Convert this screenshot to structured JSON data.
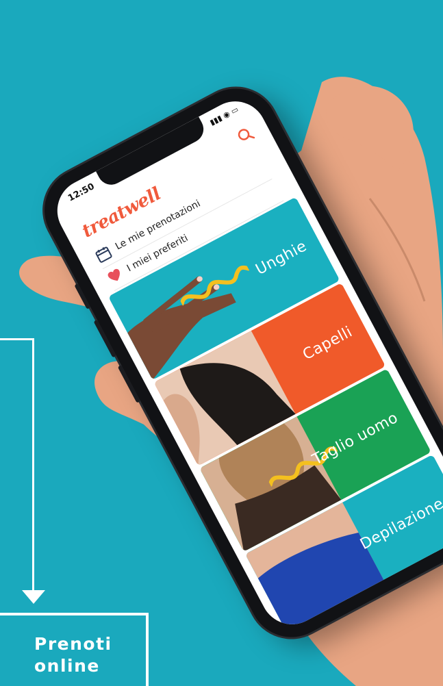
{
  "app": {
    "brand": "treatwell",
    "time": "12:50"
  },
  "menu": {
    "bookings": "Le mie prenotazioni",
    "favorites": "I miei preferiti"
  },
  "categories": [
    {
      "label": "Unghie",
      "color": "#1ab0c0"
    },
    {
      "label": "Capelli",
      "color": "#f05a2a"
    },
    {
      "label": "Taglio uomo",
      "color": "#1aa255"
    },
    {
      "label": "Depilazione",
      "color": "#1ab0c0"
    }
  ],
  "callout": {
    "line1": "Prenoti",
    "line2": "online"
  },
  "colors": {
    "background": "#1aa9bd",
    "brand": "#f05a3c",
    "accent_yellow": "#f4c01f"
  }
}
